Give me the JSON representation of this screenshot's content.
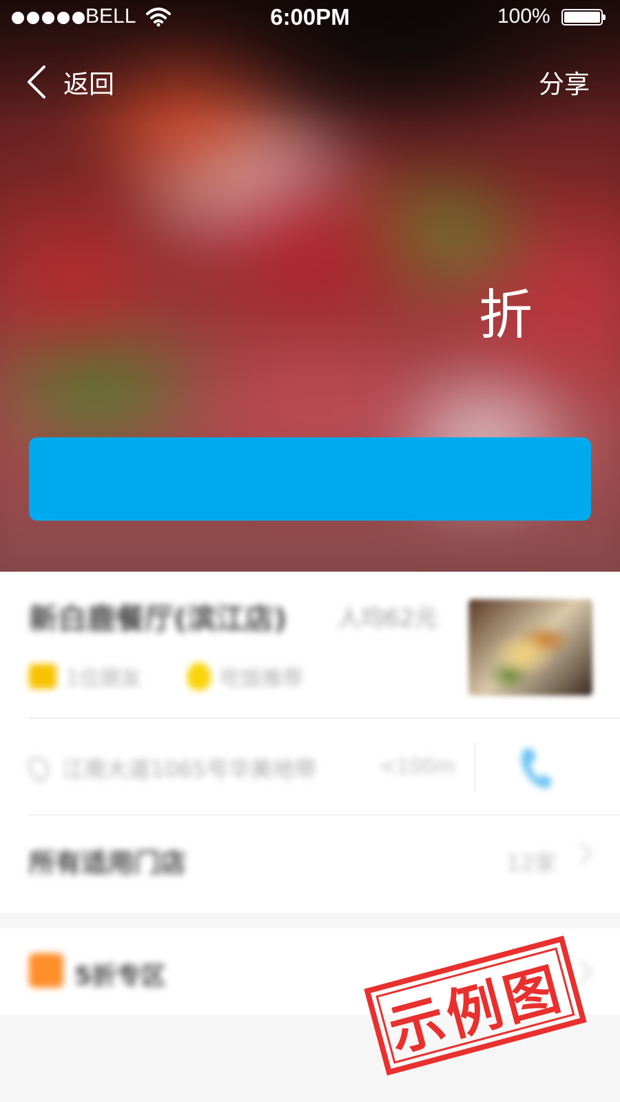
{
  "status_bar": {
    "carrier": "BELL",
    "time": "6:00PM",
    "battery": "100%"
  },
  "nav": {
    "back_label": "返回",
    "share_label": "分享"
  },
  "hero": {
    "discount_text": "折",
    "cta_label": ""
  },
  "store": {
    "name": "新白鹿餐厅(滨江店)",
    "avg_price": "人均62元",
    "tag_recommend": "1位朋友",
    "tag_tip": "吃饭推荐",
    "address": "江南大道1065号华美地带",
    "distance": "<100m",
    "all_stores_label": "所有适用门店",
    "all_stores_count": "12家"
  },
  "promo": {
    "zone_label": "5折专区"
  },
  "watermark": {
    "stamp_text": "示例图"
  },
  "colors": {
    "cta": "#00aaee",
    "stamp": "#e8302e"
  }
}
